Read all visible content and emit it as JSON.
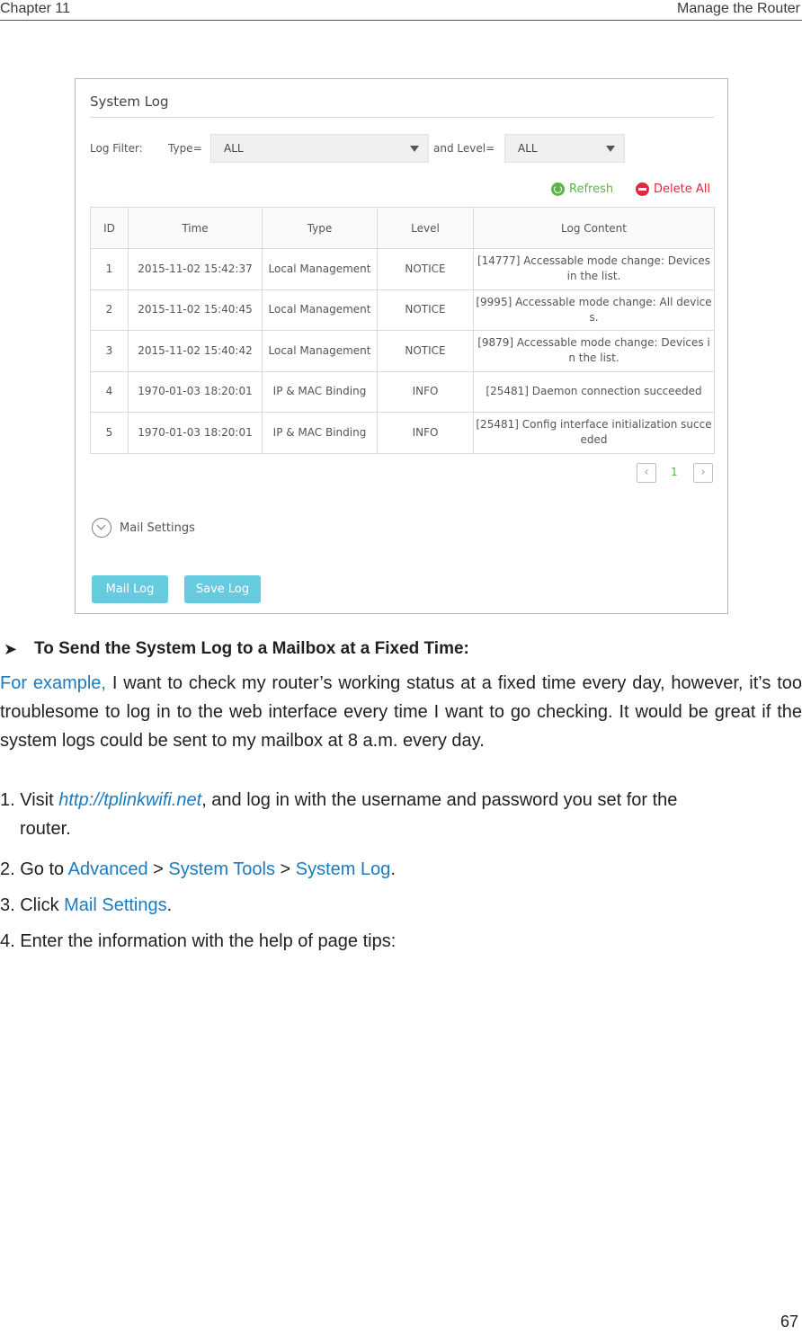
{
  "header": {
    "chapter": "Chapter 11",
    "section": "Manage the Router"
  },
  "screenshot": {
    "title": "System Log",
    "filter": {
      "label": "Log Filter:",
      "type_label": "Type=",
      "type_value": "ALL",
      "level_label": "and Level=",
      "level_value": "ALL"
    },
    "actions": {
      "refresh": "Refresh",
      "delete_all": "Delete All"
    },
    "table": {
      "columns": [
        "ID",
        "Time",
        "Type",
        "Level",
        "Log Content"
      ],
      "rows": [
        {
          "id": "1",
          "time": "2015-11-02 15:42:37",
          "type": "Local Management",
          "level": "NOTICE",
          "content": "[14777] Accessable mode change: Devices in the list."
        },
        {
          "id": "2",
          "time": "2015-11-02 15:40:45",
          "type": "Local Management",
          "level": "NOTICE",
          "content": "[9995] Accessable mode change: All devices."
        },
        {
          "id": "3",
          "time": "2015-11-02 15:40:42",
          "type": "Local Management",
          "level": "NOTICE",
          "content": "[9879] Accessable mode change: Devices in the list."
        },
        {
          "id": "4",
          "time": "1970-01-03 18:20:01",
          "type": "IP & MAC Binding",
          "level": "INFO",
          "content": "[25481] Daemon connection succeeded"
        },
        {
          "id": "5",
          "time": "1970-01-03 18:20:01",
          "type": "IP & MAC Binding",
          "level": "INFO",
          "content": "[25481] Config interface initialization succeeded"
        }
      ]
    },
    "pagination": {
      "prev_icon": "chevron-left",
      "current_page": "1",
      "next_icon": "chevron-right"
    },
    "mail_settings_label": "Mail Settings",
    "buttons": {
      "mail_log": "Mail Log",
      "save_log": "Save Log"
    },
    "colors": {
      "accent_green": "#5cb54a",
      "danger_red": "#e0283c",
      "button_blue": "#67cbe0"
    }
  },
  "doc": {
    "heading": "To Send the System Log to a Mailbox at a Fixed Time:",
    "para_lead": "For example,",
    "para_rest": " I want to check my router’s working status at a fixed time every day, however, it’s too troublesome to log in to the web interface every time I want to go checking. It would be great if the system logs could be sent to my mailbox at 8 a.m. every day.",
    "step1_prefix": "1. Visit ",
    "step1_link": "http://tplinkwifi.net",
    "step1_suffix": ", and log in with the username and password you set for the",
    "step1_cont": "router.",
    "step2_prefix": "2. Go to ",
    "step2_nav1": "Advanced",
    "step2_sep1": " > ",
    "step2_nav2": "System Tools",
    "step2_sep2": " > ",
    "step2_nav3": "System Log",
    "step2_end": ".",
    "step3_prefix": "3. Click ",
    "step3_link": "Mail Settings",
    "step3_end": ".",
    "step4": "4. Enter the information with the help of page tips:",
    "link_color": "#1a7bc0"
  },
  "page_number": "67"
}
